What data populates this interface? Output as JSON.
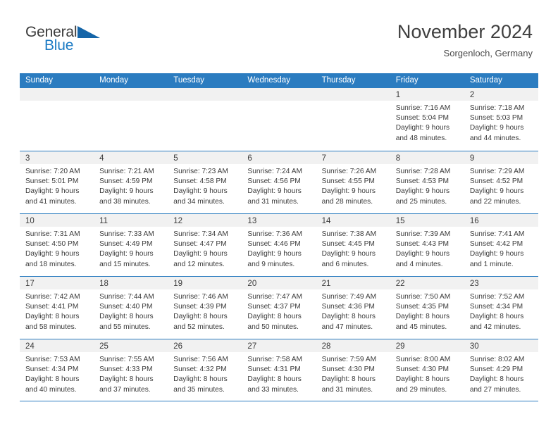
{
  "brand": {
    "name_part1": "General",
    "name_part2": "Blue",
    "triangle_color": "#1565a8",
    "blue_color": "#1c7bc4"
  },
  "header": {
    "month_title": "November 2024",
    "location": "Sorgenloch, Germany"
  },
  "theme": {
    "header_blue": "#2b7cc0",
    "date_band_gray": "#f1f1f1",
    "text_color": "#3a3a3a"
  },
  "calendar": {
    "day_headers": [
      "Sunday",
      "Monday",
      "Tuesday",
      "Wednesday",
      "Thursday",
      "Friday",
      "Saturday"
    ],
    "weeks": [
      [
        {
          "date": "",
          "lines": []
        },
        {
          "date": "",
          "lines": []
        },
        {
          "date": "",
          "lines": []
        },
        {
          "date": "",
          "lines": []
        },
        {
          "date": "",
          "lines": []
        },
        {
          "date": "1",
          "lines": [
            "Sunrise: 7:16 AM",
            "Sunset: 5:04 PM",
            "Daylight: 9 hours",
            "and 48 minutes."
          ]
        },
        {
          "date": "2",
          "lines": [
            "Sunrise: 7:18 AM",
            "Sunset: 5:03 PM",
            "Daylight: 9 hours",
            "and 44 minutes."
          ]
        }
      ],
      [
        {
          "date": "3",
          "lines": [
            "Sunrise: 7:20 AM",
            "Sunset: 5:01 PM",
            "Daylight: 9 hours",
            "and 41 minutes."
          ]
        },
        {
          "date": "4",
          "lines": [
            "Sunrise: 7:21 AM",
            "Sunset: 4:59 PM",
            "Daylight: 9 hours",
            "and 38 minutes."
          ]
        },
        {
          "date": "5",
          "lines": [
            "Sunrise: 7:23 AM",
            "Sunset: 4:58 PM",
            "Daylight: 9 hours",
            "and 34 minutes."
          ]
        },
        {
          "date": "6",
          "lines": [
            "Sunrise: 7:24 AM",
            "Sunset: 4:56 PM",
            "Daylight: 9 hours",
            "and 31 minutes."
          ]
        },
        {
          "date": "7",
          "lines": [
            "Sunrise: 7:26 AM",
            "Sunset: 4:55 PM",
            "Daylight: 9 hours",
            "and 28 minutes."
          ]
        },
        {
          "date": "8",
          "lines": [
            "Sunrise: 7:28 AM",
            "Sunset: 4:53 PM",
            "Daylight: 9 hours",
            "and 25 minutes."
          ]
        },
        {
          "date": "9",
          "lines": [
            "Sunrise: 7:29 AM",
            "Sunset: 4:52 PM",
            "Daylight: 9 hours",
            "and 22 minutes."
          ]
        }
      ],
      [
        {
          "date": "10",
          "lines": [
            "Sunrise: 7:31 AM",
            "Sunset: 4:50 PM",
            "Daylight: 9 hours",
            "and 18 minutes."
          ]
        },
        {
          "date": "11",
          "lines": [
            "Sunrise: 7:33 AM",
            "Sunset: 4:49 PM",
            "Daylight: 9 hours",
            "and 15 minutes."
          ]
        },
        {
          "date": "12",
          "lines": [
            "Sunrise: 7:34 AM",
            "Sunset: 4:47 PM",
            "Daylight: 9 hours",
            "and 12 minutes."
          ]
        },
        {
          "date": "13",
          "lines": [
            "Sunrise: 7:36 AM",
            "Sunset: 4:46 PM",
            "Daylight: 9 hours",
            "and 9 minutes."
          ]
        },
        {
          "date": "14",
          "lines": [
            "Sunrise: 7:38 AM",
            "Sunset: 4:45 PM",
            "Daylight: 9 hours",
            "and 6 minutes."
          ]
        },
        {
          "date": "15",
          "lines": [
            "Sunrise: 7:39 AM",
            "Sunset: 4:43 PM",
            "Daylight: 9 hours",
            "and 4 minutes."
          ]
        },
        {
          "date": "16",
          "lines": [
            "Sunrise: 7:41 AM",
            "Sunset: 4:42 PM",
            "Daylight: 9 hours",
            "and 1 minute."
          ]
        }
      ],
      [
        {
          "date": "17",
          "lines": [
            "Sunrise: 7:42 AM",
            "Sunset: 4:41 PM",
            "Daylight: 8 hours",
            "and 58 minutes."
          ]
        },
        {
          "date": "18",
          "lines": [
            "Sunrise: 7:44 AM",
            "Sunset: 4:40 PM",
            "Daylight: 8 hours",
            "and 55 minutes."
          ]
        },
        {
          "date": "19",
          "lines": [
            "Sunrise: 7:46 AM",
            "Sunset: 4:39 PM",
            "Daylight: 8 hours",
            "and 52 minutes."
          ]
        },
        {
          "date": "20",
          "lines": [
            "Sunrise: 7:47 AM",
            "Sunset: 4:37 PM",
            "Daylight: 8 hours",
            "and 50 minutes."
          ]
        },
        {
          "date": "21",
          "lines": [
            "Sunrise: 7:49 AM",
            "Sunset: 4:36 PM",
            "Daylight: 8 hours",
            "and 47 minutes."
          ]
        },
        {
          "date": "22",
          "lines": [
            "Sunrise: 7:50 AM",
            "Sunset: 4:35 PM",
            "Daylight: 8 hours",
            "and 45 minutes."
          ]
        },
        {
          "date": "23",
          "lines": [
            "Sunrise: 7:52 AM",
            "Sunset: 4:34 PM",
            "Daylight: 8 hours",
            "and 42 minutes."
          ]
        }
      ],
      [
        {
          "date": "24",
          "lines": [
            "Sunrise: 7:53 AM",
            "Sunset: 4:34 PM",
            "Daylight: 8 hours",
            "and 40 minutes."
          ]
        },
        {
          "date": "25",
          "lines": [
            "Sunrise: 7:55 AM",
            "Sunset: 4:33 PM",
            "Daylight: 8 hours",
            "and 37 minutes."
          ]
        },
        {
          "date": "26",
          "lines": [
            "Sunrise: 7:56 AM",
            "Sunset: 4:32 PM",
            "Daylight: 8 hours",
            "and 35 minutes."
          ]
        },
        {
          "date": "27",
          "lines": [
            "Sunrise: 7:58 AM",
            "Sunset: 4:31 PM",
            "Daylight: 8 hours",
            "and 33 minutes."
          ]
        },
        {
          "date": "28",
          "lines": [
            "Sunrise: 7:59 AM",
            "Sunset: 4:30 PM",
            "Daylight: 8 hours",
            "and 31 minutes."
          ]
        },
        {
          "date": "29",
          "lines": [
            "Sunrise: 8:00 AM",
            "Sunset: 4:30 PM",
            "Daylight: 8 hours",
            "and 29 minutes."
          ]
        },
        {
          "date": "30",
          "lines": [
            "Sunrise: 8:02 AM",
            "Sunset: 4:29 PM",
            "Daylight: 8 hours",
            "and 27 minutes."
          ]
        }
      ]
    ]
  }
}
